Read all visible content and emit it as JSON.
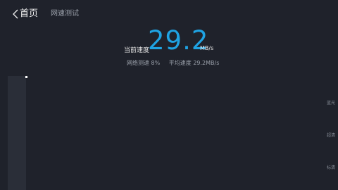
{
  "nav": {
    "back_label": "首页",
    "title": "网速测试"
  },
  "speed": {
    "label": "当前速度",
    "value": "29.2",
    "unit": "MB/s"
  },
  "stats": {
    "progress_text": "网络测速 8%",
    "average_text": "平均速度 29.2MB/s"
  },
  "quality_labels": [
    "蓝光",
    "超清",
    "标清"
  ],
  "colors": {
    "background": "#1f222b",
    "accent": "#1fa3e3"
  }
}
